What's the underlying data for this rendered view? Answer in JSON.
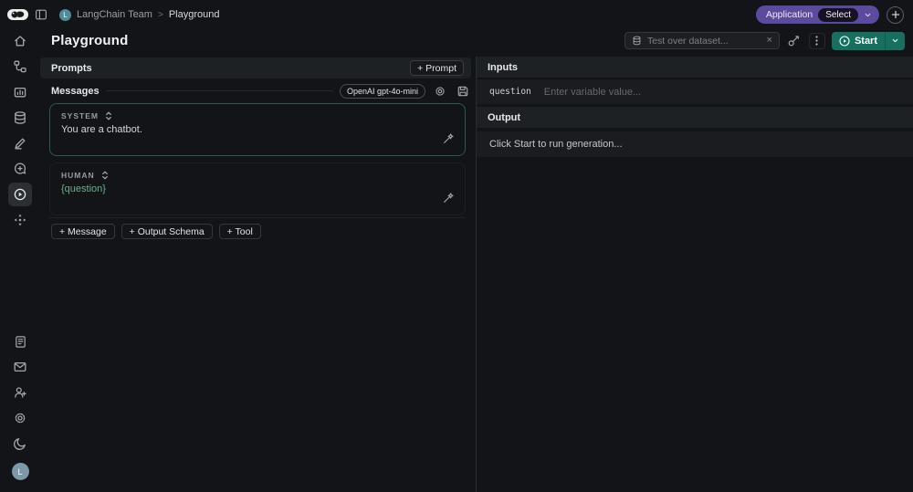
{
  "topbar": {
    "team": "LangChain Team",
    "separator": ">",
    "page": "Playground",
    "team_avatar_letter": "L",
    "application_label": "Application",
    "application_value": "Select"
  },
  "header": {
    "title": "Playground",
    "dataset_placeholder": "Test over dataset...",
    "start_label": "Start"
  },
  "sidebar": {
    "top_icons": [
      "home-icon",
      "tracing-projects-icon",
      "monitoring-icon",
      "datasets-icon",
      "annotation-icon",
      "prompts-icon",
      "playground-icon",
      "deployments-icon"
    ],
    "active": "playground-icon",
    "bottom_icons": [
      "docs-icon",
      "mail-icon",
      "invite-user-icon",
      "settings-icon",
      "dark-mode-icon"
    ],
    "avatar_letter": "L"
  },
  "left_panel": {
    "prompts_header": "Prompts",
    "add_prompt_label": "+ Prompt",
    "messages_header": "Messages",
    "model_label": "OpenAI gpt-4o-mini",
    "messages": [
      {
        "role": "SYSTEM",
        "content": "You are a chatbot."
      },
      {
        "role": "HUMAN",
        "content": "{question}"
      }
    ],
    "add_buttons": [
      "+ Message",
      "+ Output Schema",
      "+ Tool"
    ]
  },
  "right_panel": {
    "inputs_header": "Inputs",
    "variable_name": "question",
    "variable_placeholder": "Enter variable value...",
    "output_header": "Output",
    "output_placeholder": "Click Start to run generation..."
  },
  "colors": {
    "accent_purple": "#5b4a9e",
    "accent_green": "#15705f",
    "system_border": "#2e584c",
    "variable_text": "#68b18b"
  }
}
